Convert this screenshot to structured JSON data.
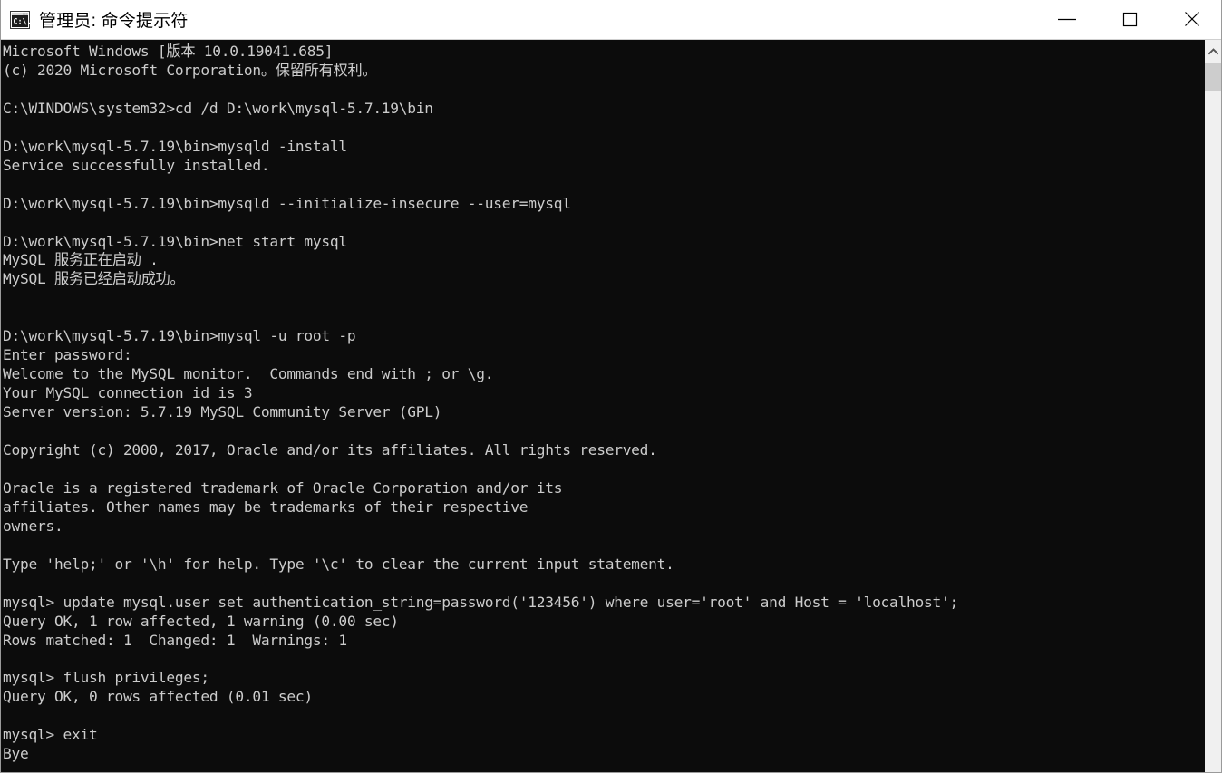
{
  "window": {
    "title": "管理员: 命令提示符",
    "icon": "command-prompt-icon",
    "background_color": "#0c0c0c",
    "text_color": "#cccccc",
    "titlebar_color": "#ffffff"
  },
  "titlebar_buttons": {
    "minimize": "minimize-icon",
    "maximize": "maximize-icon",
    "close": "close-icon"
  },
  "scrollbar": {
    "up_arrow": "chevron-up-icon",
    "thumb_color": "#cdcdcd",
    "track_color": "#f0f0f0"
  },
  "console": {
    "lines": [
      "Microsoft Windows [版本 10.0.19041.685]",
      "(c) 2020 Microsoft Corporation。保留所有权利。",
      "",
      "C:\\WINDOWS\\system32>cd /d D:\\work\\mysql-5.7.19\\bin",
      "",
      "D:\\work\\mysql-5.7.19\\bin>mysqld -install",
      "Service successfully installed.",
      "",
      "D:\\work\\mysql-5.7.19\\bin>mysqld --initialize-insecure --user=mysql",
      "",
      "D:\\work\\mysql-5.7.19\\bin>net start mysql",
      "MySQL 服务正在启动 .",
      "MySQL 服务已经启动成功。",
      "",
      "",
      "D:\\work\\mysql-5.7.19\\bin>mysql -u root -p",
      "Enter password:",
      "Welcome to the MySQL monitor.  Commands end with ; or \\g.",
      "Your MySQL connection id is 3",
      "Server version: 5.7.19 MySQL Community Server (GPL)",
      "",
      "Copyright (c) 2000, 2017, Oracle and/or its affiliates. All rights reserved.",
      "",
      "Oracle is a registered trademark of Oracle Corporation and/or its",
      "affiliates. Other names may be trademarks of their respective",
      "owners.",
      "",
      "Type 'help;' or '\\h' for help. Type '\\c' to clear the current input statement.",
      "",
      "mysql> update mysql.user set authentication_string=password('123456') where user='root' and Host = 'localhost';",
      "Query OK, 1 row affected, 1 warning (0.00 sec)",
      "Rows matched: 1  Changed: 1  Warnings: 1",
      "",
      "mysql> flush privileges;",
      "Query OK, 0 rows affected (0.01 sec)",
      "",
      "mysql> exit",
      "Bye"
    ]
  }
}
